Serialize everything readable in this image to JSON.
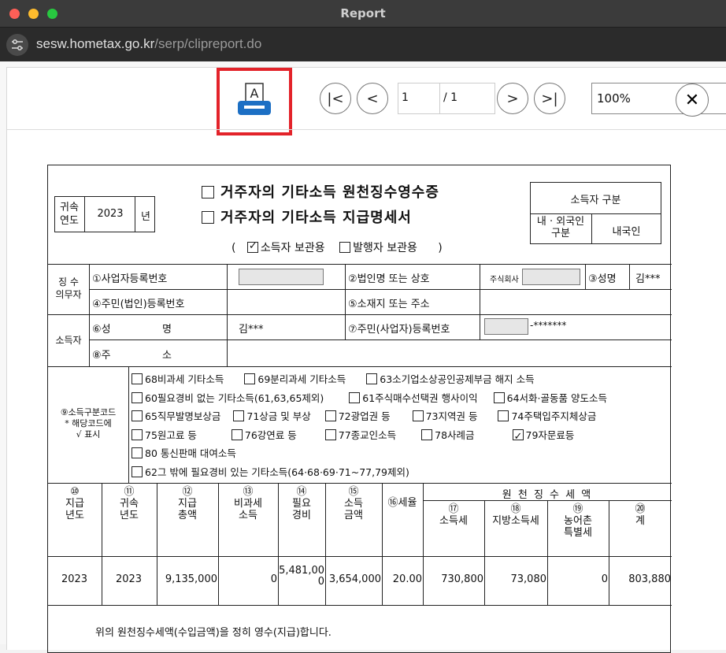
{
  "window": {
    "title": "Report"
  },
  "browser": {
    "url_host": "sesw.hometax.go.kr",
    "url_path": "/serp/clipreport.do"
  },
  "toolbar": {
    "page_current": "1",
    "page_total": "/ 1",
    "zoom": "100%"
  },
  "form": {
    "year_label": "귀속\n연도",
    "year_value": "2023",
    "year_suffix": "년",
    "title1": "거주자의 기타소득 원천징수영수증",
    "title2": "거주자의 기타소득 지급명세서",
    "copy_open": "(",
    "copy_holder": "소득자 보관용",
    "copy_issuer": "발행자 보관용",
    "copy_close": ")",
    "residency_title": "소득자 구분",
    "residency_label": "내 · 외국인\n구분",
    "residency_value": "내국인",
    "payer_label": "징 수\n의무자",
    "f1": "①사업자등록번호",
    "f2": "②법인명 또는 상호",
    "f2_prefix": "주식회사",
    "f3": "③성명",
    "f3_value": "김***",
    "f4": "④주민(법인)등록번호",
    "f5": "⑤소재지 또는 주소",
    "earner_label": "소득자",
    "f6": "⑥성",
    "f6b": "명",
    "f6_value": "김***",
    "f7": "⑦주민(사업자)등록번호",
    "f7_value": "-*******",
    "f8": "⑧주",
    "f8b": "소",
    "code_label": "⑨소득구분코드\n* 해당코드에\n√ 표시",
    "codes": [
      [
        "68비과세 기타소득",
        "69분리과세 기타소득",
        "63소기업소상공인공제부금 해지 소득"
      ],
      [
        "60필요경비 없는 기타소득(61,63,65제외)",
        "61주식매수선택권 행사이익",
        "64서화·골동품 양도소득"
      ],
      [
        "65직무발명보상금",
        "71상금 및 부상",
        "72광업권 등",
        "73지역권 등",
        "74주택입주지체상금"
      ],
      [
        "75원고료 등",
        "76강연료 등",
        "77종교인소득",
        "78사례금",
        "79자문료등"
      ],
      [
        "80 통신판매 대여소득"
      ],
      [
        "62그 밖에 필요경비 있는 기타소득(64·68·69·71~77,79제외)"
      ]
    ],
    "table_headers": [
      "⑩\n지급\n년도",
      "⑪\n귀속\n년도",
      "⑫\n지급\n총액",
      "⑬\n비과세\n소득",
      "⑭\n필요\n경비",
      "⑮\n소득\n금액",
      "⑯세율",
      "⑰\n소득세",
      "⑱\n지방소득세",
      "⑲\n농어촌\n특별세",
      "⑳\n계"
    ],
    "withholding_header": "원 천 징 수 세 액",
    "row": [
      "2023",
      "2023",
      "9,135,000",
      "0",
      "5,481,00\n0",
      "3,654,000",
      "20.00",
      "730,800",
      "73,080",
      "0",
      "803,880"
    ],
    "footer": "위의 원천징수세액(수입금액)을 정히 영수(지급)합니다."
  }
}
